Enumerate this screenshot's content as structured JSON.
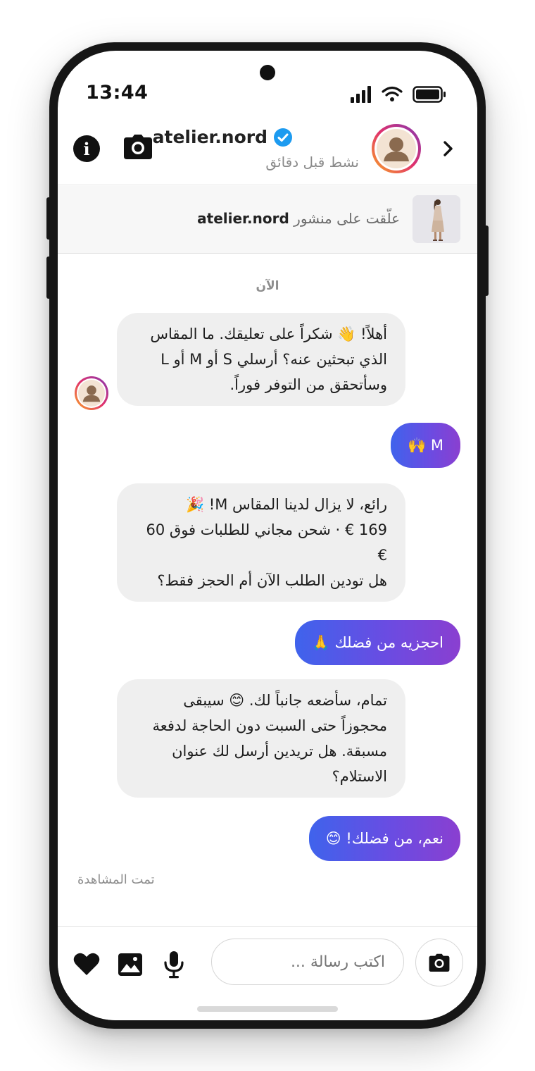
{
  "status_bar": {
    "time": "13:44"
  },
  "header": {
    "username": "atelier.nord",
    "activity": "نشط قبل دقائق"
  },
  "post_banner": {
    "prefix": "علّقت على منشور ",
    "account": "atelier.nord"
  },
  "thread": {
    "timestamp": "الآن",
    "messages": [
      {
        "from": "them",
        "lines": [
          "أهلاً! 👋 شكراً على تعليقك. ما المقاس",
          "الذي تبحثين عنه؟ أرسلي S أو M أو L",
          "وسأتحقق من التوفر فوراً."
        ]
      },
      {
        "from": "me",
        "text": "M 🙌"
      },
      {
        "from": "them",
        "lines": [
          "رائع، لا يزال لدينا المقاس M! 🎉",
          "169 € · شحن مجاني للطلبات فوق 60",
          "€",
          "هل تودين الطلب الآن أم الحجز فقط؟"
        ]
      },
      {
        "from": "me",
        "text": "احجزيه من فضلك 🙏"
      },
      {
        "from": "them",
        "lines": [
          "تمام، سأضعه جانباً لك. 😊 سيبقى",
          "محجوزاً حتى السبت دون الحاجة لدفعة",
          "مسبقة. هل تريدين أرسل لك عنوان",
          "الاستلام؟"
        ]
      },
      {
        "from": "me",
        "text": "نعم، من فضلك! 😊"
      }
    ],
    "seen_label": "تمت المشاهدة"
  },
  "composer": {
    "placeholder": "اكتب رسالة ..."
  },
  "colors": {
    "outgoing_gradient": [
      "#3f63ec",
      "#8a3fd0"
    ],
    "incoming_bubble": "#efefef",
    "verified_badge": "#1d9bf0"
  },
  "icons": [
    "info-icon",
    "camera-icon",
    "verified-badge-icon",
    "back-chevron-icon",
    "heart-icon",
    "image-icon",
    "microphone-icon",
    "signal-icon",
    "wifi-icon",
    "battery-icon"
  ]
}
